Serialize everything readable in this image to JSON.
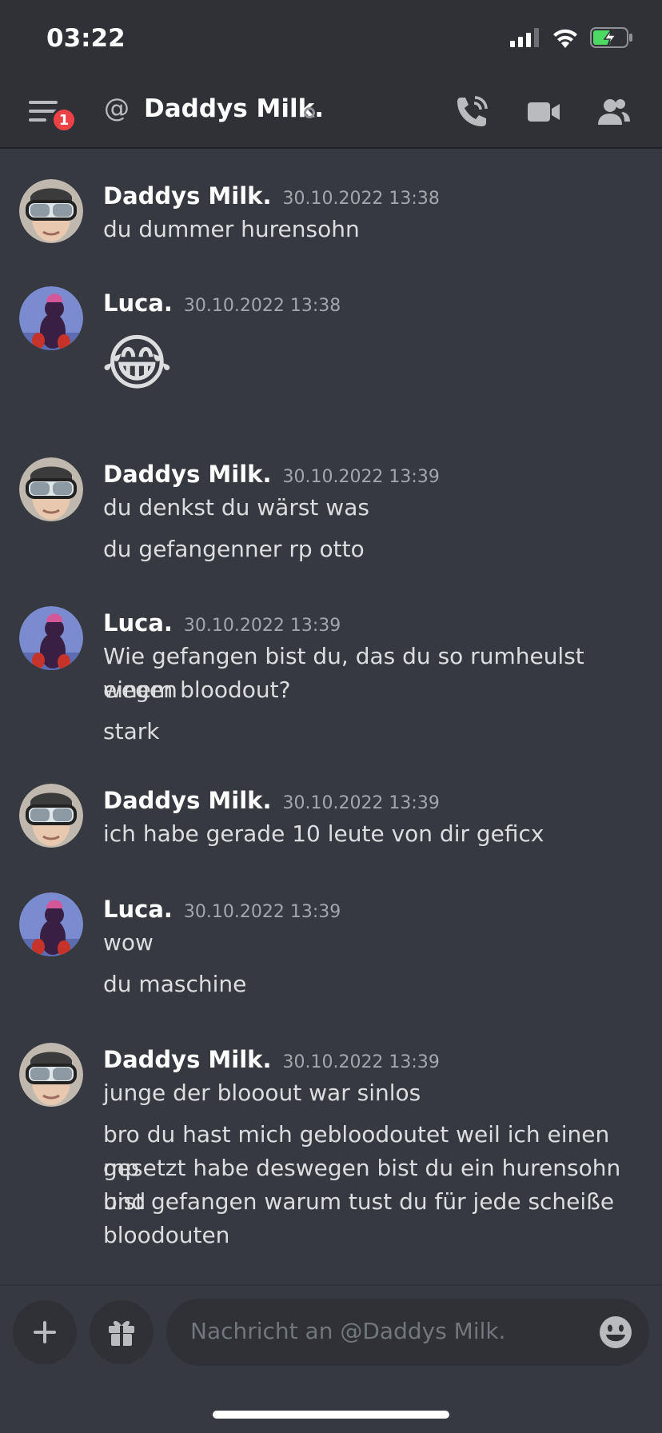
{
  "status_bar": {
    "time": "03:22"
  },
  "header": {
    "menu_badge": "1",
    "at_symbol": "@",
    "title": "Daddys Milk."
  },
  "messages": [
    {
      "author": "Daddys Milk.",
      "timestamp": "30.10.2022 13:38",
      "lines": [
        "du dummer hurensohn"
      ]
    },
    {
      "author": "Luca.",
      "timestamp": "30.10.2022 13:38",
      "emoji": "😂"
    },
    {
      "author": "Daddys Milk.",
      "timestamp": "30.10.2022 13:39",
      "lines": [
        "du denkst du wärst was",
        "du gefangenner rp otto"
      ]
    },
    {
      "author": "Luca.",
      "timestamp": "30.10.2022 13:39",
      "lines": [
        "Wie gefangen bist du, das du so rumheulst wegen",
        "einem bloodout?",
        "stark"
      ]
    },
    {
      "author": "Daddys Milk.",
      "timestamp": "30.10.2022 13:39",
      "lines": [
        "ich habe gerade 10 leute von dir geficx"
      ]
    },
    {
      "author": "Luca.",
      "timestamp": "30.10.2022 13:39",
      "lines": [
        "wow",
        "du maschine"
      ]
    },
    {
      "author": "Daddys Milk.",
      "timestamp": "30.10.2022 13:39",
      "lines": [
        "junge der blooout war sinlos",
        "bro du hast mich gebloodoutet weil ich einen mp",
        "gesetzt habe deswegen bist du ein hurensohn und",
        "bist gefangen warum tust du für jede scheiße",
        "bloodouten"
      ]
    }
  ],
  "composer": {
    "placeholder": "Nachricht an @Daddys Milk."
  },
  "colors": {
    "background": "#36393f",
    "header": "#2f3136",
    "badge": "#ed4245"
  }
}
